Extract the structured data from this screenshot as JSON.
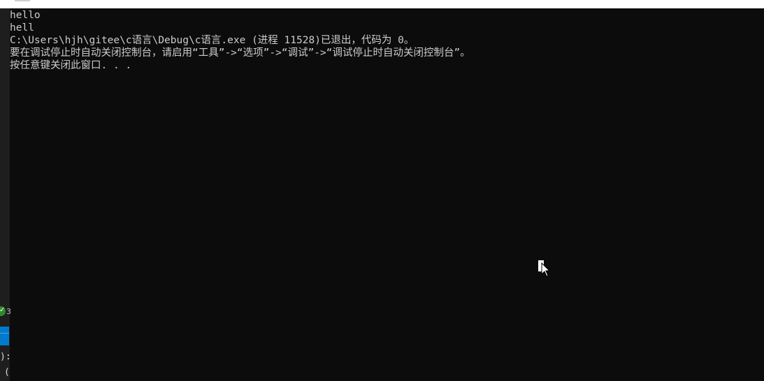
{
  "console": {
    "lines": [
      "hello",
      "hell",
      "C:\\Users\\hjh\\gitee\\c语言\\Debug\\c语言.exe (进程 11528)已退出，代码为 0。",
      "要在调试停止时自动关闭控制台，请启用“工具”->“选项”->“调试”->“调试停止时自动关闭控制台”。",
      "按任意键关闭此窗口. . ."
    ]
  },
  "background_window": {
    "glyph_1": "3",
    "text_1": "):",
    "text_2": "("
  },
  "colors": {
    "console_background": "#0c0c0c",
    "console_text": "#cccccc",
    "accent_blue": "#007acc",
    "status_green": "#2e8b2e"
  },
  "icons": {
    "status": "check-circle-icon",
    "cursor": "mouse-pointer-icon"
  }
}
